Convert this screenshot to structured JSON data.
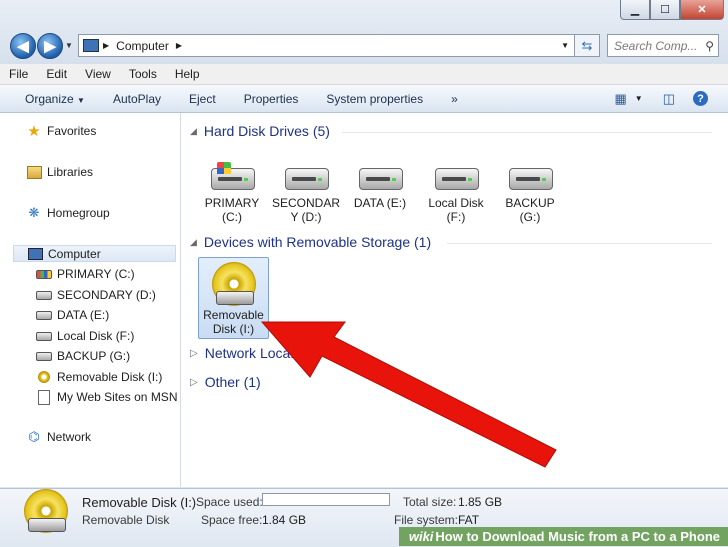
{
  "window": {
    "controls": [
      "minimize",
      "maximize",
      "close"
    ]
  },
  "address": {
    "path": "Computer",
    "search_placeholder": "Search Comp..."
  },
  "menubar": [
    "File",
    "Edit",
    "View",
    "Tools",
    "Help"
  ],
  "commandbar": [
    "Organize",
    "AutoPlay",
    "Eject",
    "Properties",
    "System properties",
    "»"
  ],
  "navpane": {
    "favorites": "Favorites",
    "libraries": "Libraries",
    "homegroup": "Homegroup",
    "computer": "Computer",
    "drives": [
      "PRIMARY (C:)",
      "SECONDARY (D:)",
      "DATA (E:)",
      "Local Disk (F:)",
      "BACKUP (G:)",
      "Removable Disk (I:)",
      "My Web Sites on MSN"
    ],
    "network": "Network"
  },
  "content": {
    "hard_disk_header": "Hard Disk Drives (5)",
    "hard_disks": [
      {
        "line1": "PRIMARY",
        "line2": "(C:)"
      },
      {
        "line1": "SECONDAR",
        "line2": "Y (D:)"
      },
      {
        "line1": "DATA (E:)",
        "line2": ""
      },
      {
        "line1": "Local Disk",
        "line2": "(F:)"
      },
      {
        "line1": "BACKUP",
        "line2": "(G:)"
      }
    ],
    "removable_header": "Devices with Removable Storage (1)",
    "removable": {
      "line1": "Removable",
      "line2": "Disk (I:)"
    },
    "network_header": "Network Loca...",
    "other_header": "Other (1)"
  },
  "status": {
    "name": "Removable Disk (I:)",
    "type": "Removable Disk",
    "space_used_label": "Space used:",
    "space_free_label": "Space free:",
    "space_free": "1.84 GB",
    "total_size_label": "Total size:",
    "total_size": "1.85 GB",
    "file_system_label": "File system:",
    "file_system": "FAT"
  },
  "watermark": {
    "brand": "wiki",
    "title": "How to Download Music from a PC to a Phone"
  },
  "colors": {
    "arrow": "#e8140c",
    "group_header": "#1e3287",
    "selection": "#c9dcf3"
  }
}
